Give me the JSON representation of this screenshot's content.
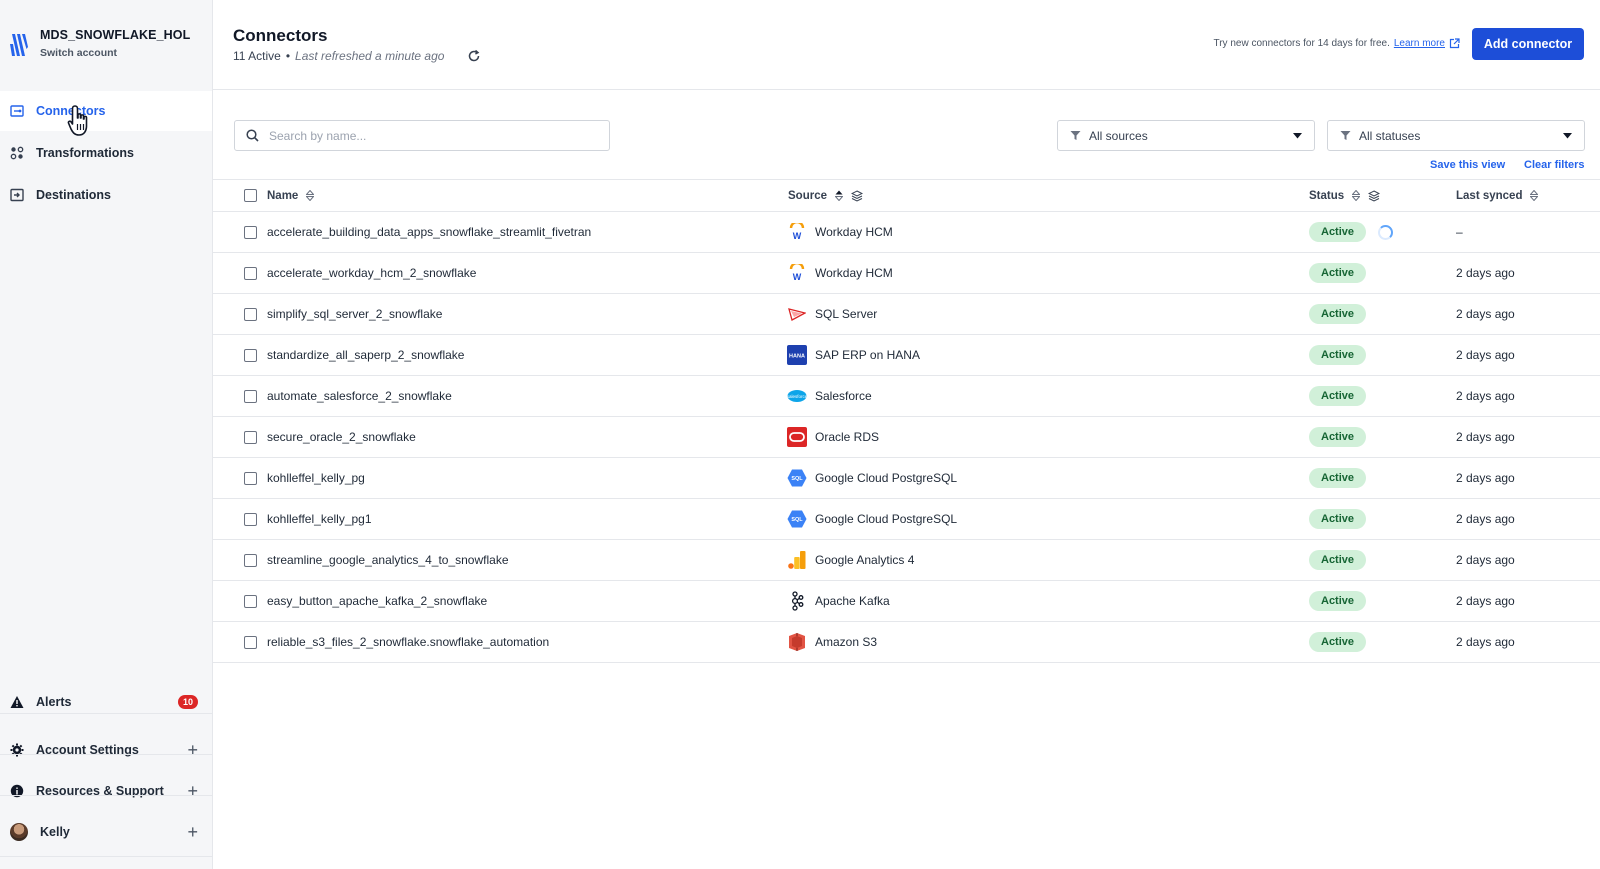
{
  "sidebar": {
    "account_name": "MDS_SNOWFLAKE_HOL",
    "account_switch": "Switch account",
    "nav": [
      {
        "label": "Connectors",
        "icon": "connector-icon"
      },
      {
        "label": "Transformations",
        "icon": "transformations-icon"
      },
      {
        "label": "Destinations",
        "icon": "destination-icon"
      }
    ],
    "bottom": {
      "alerts_label": "Alerts",
      "alerts_count": "10",
      "account_settings_label": "Account Settings",
      "resources_label": "Resources & Support",
      "user_label": "Kelly"
    }
  },
  "header": {
    "title": "Connectors",
    "active_count": "11 Active",
    "separator": "•",
    "refreshed": "Last refreshed a minute ago",
    "promo_text": "Try new connectors for 14 days for free.",
    "learn_more": "Learn more",
    "add_button": "Add connector"
  },
  "filters": {
    "search_placeholder": "Search by name...",
    "sources_value": "All sources",
    "statuses_value": "All statuses",
    "save_view": "Save this view",
    "clear_filters": "Clear filters"
  },
  "table": {
    "columns": {
      "name": "Name",
      "source": "Source",
      "status": "Status",
      "last_synced": "Last synced"
    },
    "rows": [
      {
        "name": "accelerate_building_data_apps_snowflake_streamlit_fivetran",
        "source": "Workday HCM",
        "source_icon": "workday-icon",
        "status": "Active",
        "syncing": true,
        "last_synced": "–"
      },
      {
        "name": "accelerate_workday_hcm_2_snowflake",
        "source": "Workday HCM",
        "source_icon": "workday-icon",
        "status": "Active",
        "syncing": false,
        "last_synced": "2 days ago"
      },
      {
        "name": "simplify_sql_server_2_snowflake",
        "source": "SQL Server",
        "source_icon": "sql-server-icon",
        "status": "Active",
        "syncing": false,
        "last_synced": "2 days ago"
      },
      {
        "name": "standardize_all_saperp_2_snowflake",
        "source": "SAP ERP on HANA",
        "source_icon": "sap-hana-icon",
        "status": "Active",
        "syncing": false,
        "last_synced": "2 days ago"
      },
      {
        "name": "automate_salesforce_2_snowflake",
        "source": "Salesforce",
        "source_icon": "salesforce-icon",
        "status": "Active",
        "syncing": false,
        "last_synced": "2 days ago"
      },
      {
        "name": "secure_oracle_2_snowflake",
        "source": "Oracle RDS",
        "source_icon": "oracle-icon",
        "status": "Active",
        "syncing": false,
        "last_synced": "2 days ago"
      },
      {
        "name": "kohlleffel_kelly_pg",
        "source": "Google Cloud PostgreSQL",
        "source_icon": "google-cloud-sql-icon",
        "status": "Active",
        "syncing": false,
        "last_synced": "2 days ago"
      },
      {
        "name": "kohlleffel_kelly_pg1",
        "source": "Google Cloud PostgreSQL",
        "source_icon": "google-cloud-sql-icon",
        "status": "Active",
        "syncing": false,
        "last_synced": "2 days ago"
      },
      {
        "name": "streamline_google_analytics_4_to_snowflake",
        "source": "Google Analytics 4",
        "source_icon": "google-analytics-icon",
        "status": "Active",
        "syncing": false,
        "last_synced": "2 days ago"
      },
      {
        "name": "easy_button_apache_kafka_2_snowflake",
        "source": "Apache Kafka",
        "source_icon": "kafka-icon",
        "status": "Active",
        "syncing": false,
        "last_synced": "2 days ago"
      },
      {
        "name": "reliable_s3_files_2_snowflake.snowflake_automation",
        "source": "Amazon S3",
        "source_icon": "amazon-s3-icon",
        "status": "Active",
        "syncing": false,
        "last_synced": "2 days ago"
      }
    ]
  },
  "colors": {
    "accent": "#1d4ed8",
    "active_pill_bg": "#d1f0d9",
    "active_pill_text": "#166534",
    "alert_badge": "#dc2626"
  }
}
